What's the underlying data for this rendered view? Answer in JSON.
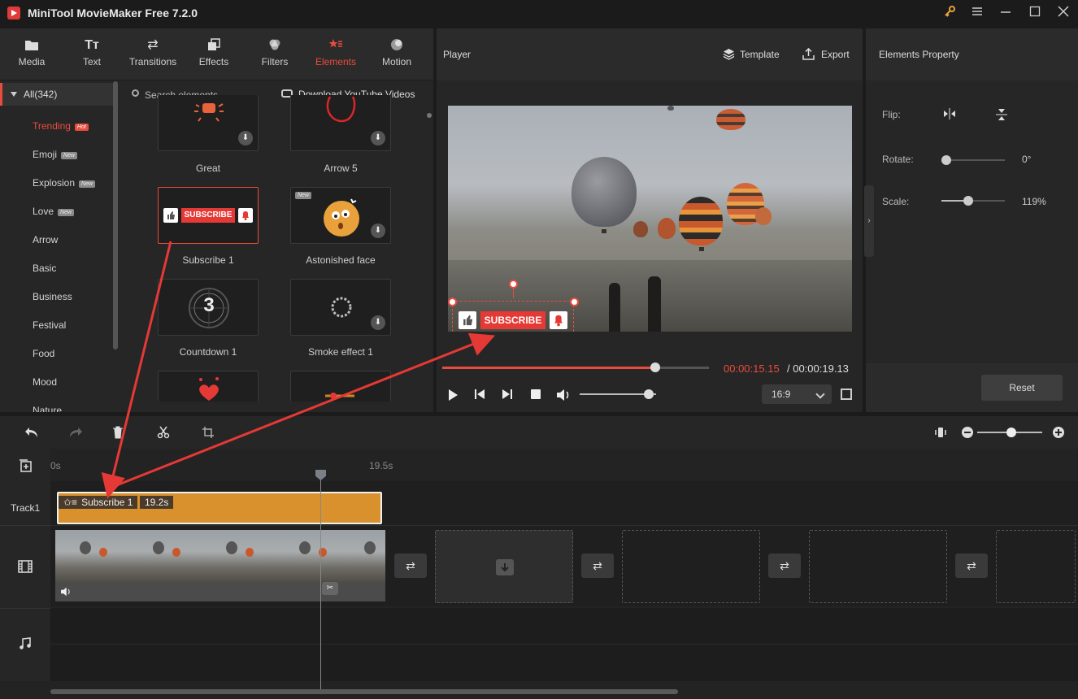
{
  "app": {
    "title": "MiniTool MovieMaker Free 7.2.0"
  },
  "window_controls": {
    "key_icon": "key-icon",
    "menu_icon": "menu-icon",
    "minimize_icon": "minimize-icon",
    "maximize_icon": "maximize-icon",
    "close_icon": "close-icon"
  },
  "library": {
    "tabs": [
      {
        "label": "Media",
        "icon": "folder-icon"
      },
      {
        "label": "Text",
        "icon": "text-icon"
      },
      {
        "label": "Transitions",
        "icon": "transitions-icon"
      },
      {
        "label": "Effects",
        "icon": "effects-icon"
      },
      {
        "label": "Filters",
        "icon": "filters-icon"
      },
      {
        "label": "Elements",
        "icon": "elements-icon",
        "active": true
      },
      {
        "label": "Motion",
        "icon": "motion-icon"
      }
    ],
    "categories": {
      "all": "All(342)",
      "items": [
        {
          "label": "Trending",
          "badge": "Hot",
          "active": true
        },
        {
          "label": "Emoji",
          "badge": "New"
        },
        {
          "label": "Explosion",
          "badge": "New"
        },
        {
          "label": "Love",
          "badge": "New"
        },
        {
          "label": "Arrow"
        },
        {
          "label": "Basic"
        },
        {
          "label": "Business"
        },
        {
          "label": "Festival"
        },
        {
          "label": "Food"
        },
        {
          "label": "Mood"
        },
        {
          "label": "Nature"
        }
      ]
    },
    "search": {
      "placeholder": "Search elements"
    },
    "download_youtube": "Download YouTube Videos",
    "elements": [
      {
        "label": "Great"
      },
      {
        "label": "Arrow 5"
      },
      {
        "label": "Subscribe 1",
        "selected": true
      },
      {
        "label": "Astonished face",
        "badge": "New"
      },
      {
        "label": "Countdown 1"
      },
      {
        "label": "Smoke effect 1"
      }
    ],
    "subscribe_text": "SUBSCRIBE",
    "countdown_digit": "3"
  },
  "player": {
    "title": "Player",
    "template_label": "Template",
    "export_label": "Export",
    "overlay_text": "SUBSCRIBE",
    "current_time": "00:00:15.15",
    "total_time": "/ 00:00:19.13",
    "progress": 0.8,
    "volume": 0.9,
    "aspect_ratio": "16:9"
  },
  "properties": {
    "title": "Elements Property",
    "flip_label": "Flip:",
    "rotate_label": "Rotate:",
    "rotate_value": "0°",
    "rotate_level": 0.0,
    "scale_label": "Scale:",
    "scale_value": "119%",
    "scale_level": 0.35,
    "reset_label": "Reset"
  },
  "timeline": {
    "ruler_start": "0s",
    "ruler_mark": "19.5s",
    "zoom_level": 0.45,
    "track1_label": "Track1",
    "element_clip_name": "Subscribe 1",
    "element_clip_duration": "19.2s"
  },
  "colors": {
    "accent": "#e84c3d",
    "clip": "#d8912c",
    "background": "#262626"
  }
}
